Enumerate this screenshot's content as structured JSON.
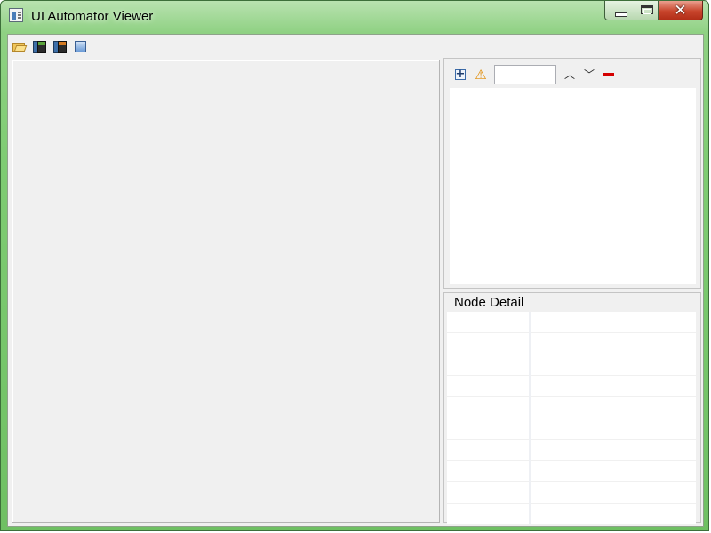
{
  "window": {
    "title": "UI Automator Viewer",
    "close_glyph": "✕"
  },
  "toolbar": {
    "icons": [
      "open-folder-icon",
      "device-screenshot-icon",
      "device-screenshot-compressed-icon",
      "save-icon"
    ]
  },
  "tree_toolbar": {
    "icons": [
      "expand-all-icon",
      "toggle-nafs-warning-icon",
      "search-input",
      "previous-icon",
      "next-icon",
      "clear-icon"
    ],
    "warn_glyph": "⚠",
    "prev_glyph": "︿",
    "next_glyph": "﹀",
    "search_value": "",
    "search_placeholder": ""
  },
  "node_detail": {
    "title": "Node Detail",
    "rows": [
      [
        "",
        ""
      ],
      [
        "",
        ""
      ],
      [
        "",
        ""
      ],
      [
        "",
        ""
      ],
      [
        "",
        ""
      ],
      [
        "",
        ""
      ],
      [
        "",
        ""
      ],
      [
        "",
        ""
      ],
      [
        "",
        ""
      ],
      [
        "",
        ""
      ]
    ]
  },
  "colors": {
    "titlebar_green": "#7fcc73",
    "close_red": "#c8452c",
    "client_bg": "#f0f0f0"
  }
}
